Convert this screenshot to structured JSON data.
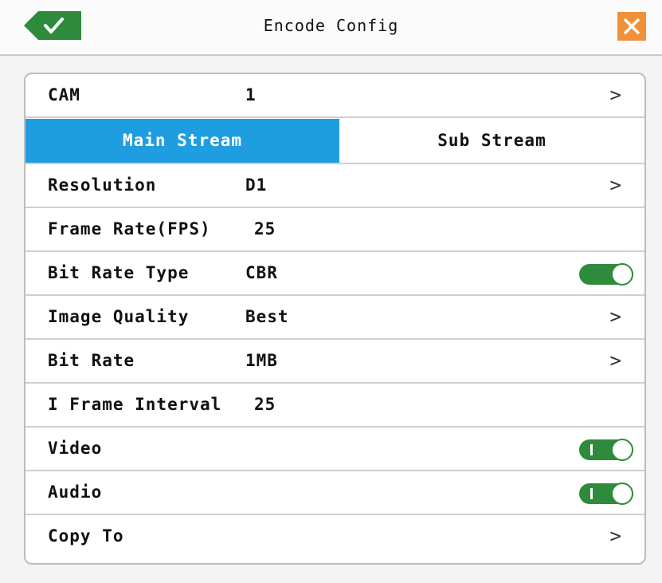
{
  "header": {
    "title": "Encode Config",
    "ok_icon": "check-icon",
    "close_icon": "close-icon",
    "ok_color": "#2f8b3c",
    "close_color": "#f0913a"
  },
  "cam": {
    "label": "CAM",
    "value": "1"
  },
  "tabs": {
    "main": "Main Stream",
    "sub": "Sub Stream",
    "active": "Main Stream",
    "active_color": "#1e9de0"
  },
  "rows": {
    "resolution": {
      "label": "Resolution",
      "value": "D1"
    },
    "frame_rate": {
      "label": "Frame Rate(FPS)",
      "value": "25"
    },
    "bit_rate_type": {
      "label": "Bit Rate Type",
      "value": "CBR",
      "toggle_on": true
    },
    "image_quality": {
      "label": "Image Quality",
      "value": "Best"
    },
    "bit_rate": {
      "label": "Bit Rate",
      "value": "1MB"
    },
    "i_frame_interval": {
      "label": "I Frame Interval",
      "value": "25"
    },
    "video": {
      "label": "Video",
      "toggle_on": true
    },
    "audio": {
      "label": "Audio",
      "toggle_on": true
    },
    "copy_to": {
      "label": "Copy To"
    }
  },
  "chevron": ">"
}
